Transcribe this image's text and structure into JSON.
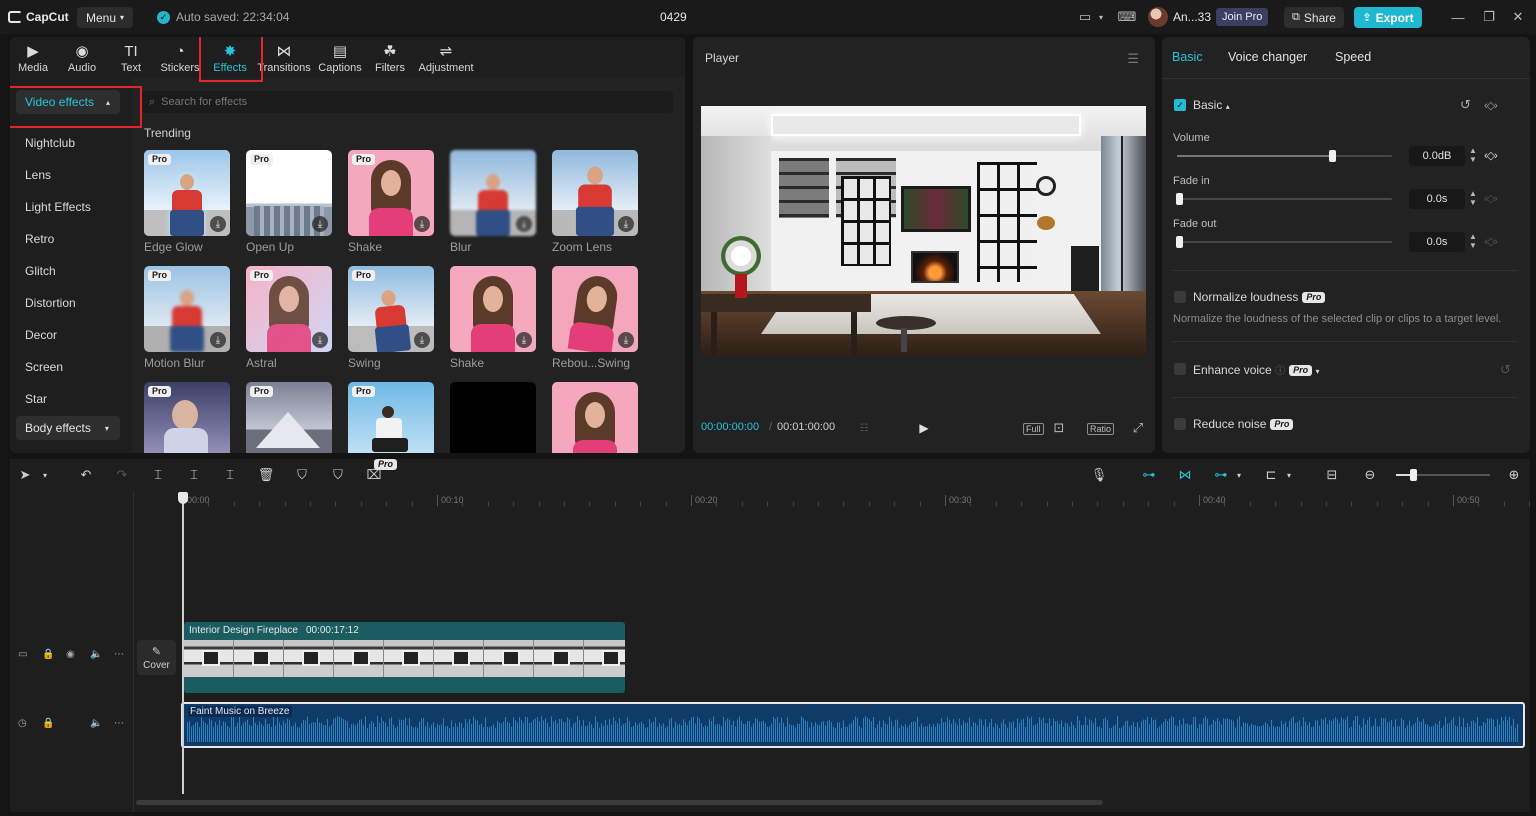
{
  "app": {
    "logo": "CapCut",
    "menu_label": "Menu",
    "autosave": "Auto saved: 22:34:04",
    "project_title": "0429",
    "user_name": "An...33",
    "join_pro": "Join Pro",
    "share": "Share",
    "export": "Export"
  },
  "tools": [
    {
      "label": "Media",
      "icon": "media-icon"
    },
    {
      "label": "Audio",
      "icon": "audio-icon"
    },
    {
      "label": "Text",
      "icon": "text-icon"
    },
    {
      "label": "Stickers",
      "icon": "stickers-icon"
    },
    {
      "label": "Effects",
      "icon": "effects-icon",
      "active": true
    },
    {
      "label": "Transitions",
      "icon": "transitions-icon"
    },
    {
      "label": "Captions",
      "icon": "captions-icon"
    },
    {
      "label": "Filters",
      "icon": "filters-icon"
    },
    {
      "label": "Adjustment",
      "icon": "adjustment-icon"
    }
  ],
  "effects": {
    "category_selected": "Video effects",
    "categories": [
      "Nightclub",
      "Lens",
      "Light Effects",
      "Retro",
      "Glitch",
      "Distortion",
      "Decor",
      "Screen",
      "Star"
    ],
    "category_bottom": "Body effects",
    "search_placeholder": "Search for effects",
    "section_title": "Trending",
    "cards": [
      {
        "label": "Edge Glow",
        "pro": "Pro"
      },
      {
        "label": "Open Up",
        "pro": "Pro"
      },
      {
        "label": "Shake",
        "pro": "Pro"
      },
      {
        "label": "Blur",
        "pro": ""
      },
      {
        "label": "Zoom Lens",
        "pro": ""
      },
      {
        "label": "Motion Blur",
        "pro": "Pro"
      },
      {
        "label": "Astral",
        "pro": "Pro"
      },
      {
        "label": "Swing",
        "pro": "Pro"
      },
      {
        "label": "Shake",
        "pro": ""
      },
      {
        "label": "Rebou...Swing",
        "pro": ""
      },
      {
        "label": "",
        "pro": "Pro"
      },
      {
        "label": "",
        "pro": "Pro"
      },
      {
        "label": "",
        "pro": "Pro"
      },
      {
        "label": "",
        "pro": ""
      },
      {
        "label": "",
        "pro": ""
      }
    ]
  },
  "player": {
    "title": "Player",
    "time_current": "00:00:00:00",
    "time_separator": "/",
    "time_total": "00:01:00:00",
    "full_label": "Full",
    "ratio_label": "Ratio"
  },
  "inspector": {
    "tabs": [
      "Basic",
      "Voice changer",
      "Speed"
    ],
    "section": "Basic",
    "volume_label": "Volume",
    "volume_value": "0.0dB",
    "volume_level": 0.72,
    "fade_in_label": "Fade in",
    "fade_in_value": "0.0s",
    "fade_out_label": "Fade out",
    "fade_out_value": "0.0s",
    "normalize_label": "Normalize loudness",
    "normalize_desc": "Normalize the loudness of the selected clip or clips to a target level.",
    "enhance_label": "Enhance voice",
    "reduce_label": "Reduce noise",
    "pro": "Pro"
  },
  "timeline": {
    "ruler": [
      "00:00",
      "00:10",
      "00:20",
      "00:30",
      "00:40",
      "00:50"
    ],
    "cover_label": "Cover",
    "pro_badge": "Pro",
    "video_clip": {
      "name": "Interior Design Fireplace",
      "duration": "00:00:17:12"
    },
    "audio_clip": {
      "name": "Faint Music on Breeze"
    }
  },
  "colors": {
    "accent": "#25c3da",
    "highlight_box": "#e5242e",
    "video_track": "#1a5c60",
    "audio_track": "#0f3b69"
  }
}
